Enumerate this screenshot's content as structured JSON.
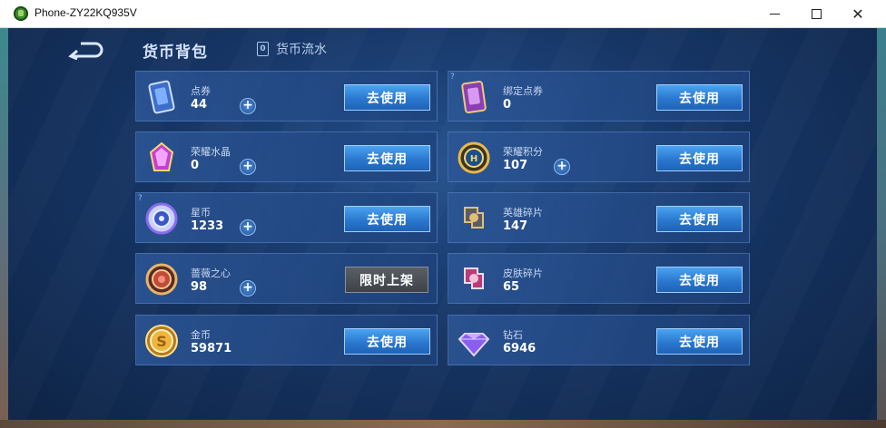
{
  "window": {
    "title": "Phone-ZY22KQ935V"
  },
  "header": {
    "title": "货币背包",
    "flow_tab": "货币流水",
    "flow_icon_glyph": "0"
  },
  "currencies": [
    {
      "name": "点券",
      "amount": "44",
      "action": "去使用",
      "has_plus": true,
      "has_help": false,
      "icon": "voucher-card-icon"
    },
    {
      "name": "绑定点券",
      "amount": "0",
      "action": "去使用",
      "has_plus": false,
      "has_help": true,
      "icon": "bound-voucher-card-icon"
    },
    {
      "name": "荣耀水晶",
      "amount": "0",
      "action": "去使用",
      "has_plus": true,
      "has_help": false,
      "icon": "glory-crystal-icon"
    },
    {
      "name": "荣耀积分",
      "amount": "107",
      "action": "去使用",
      "has_plus": true,
      "has_help": false,
      "icon": "glory-points-icon"
    },
    {
      "name": "星币",
      "amount": "1233",
      "action": "去使用",
      "has_plus": true,
      "has_help": true,
      "icon": "star-coin-icon"
    },
    {
      "name": "英雄碎片",
      "amount": "147",
      "action": "去使用",
      "has_plus": false,
      "has_help": false,
      "icon": "hero-fragment-icon"
    },
    {
      "name": "蔷薇之心",
      "amount": "98",
      "action": "限时上架",
      "has_plus": true,
      "has_help": false,
      "icon": "rose-heart-icon"
    },
    {
      "name": "皮肤碎片",
      "amount": "65",
      "action": "去使用",
      "has_plus": false,
      "has_help": false,
      "icon": "skin-fragment-icon"
    },
    {
      "name": "金币",
      "amount": "59871",
      "action": "去使用",
      "has_plus": false,
      "has_help": false,
      "icon": "gold-coin-icon"
    },
    {
      "name": "钻石",
      "amount": "6946",
      "action": "去使用",
      "has_plus": false,
      "has_help": false,
      "icon": "diamond-icon"
    }
  ],
  "help_glyph": "?",
  "plus_glyph": "+",
  "colors": {
    "accent_button": "#2a78cf",
    "card_bg": "#2c5696",
    "limited_button": "#4a4e54"
  }
}
